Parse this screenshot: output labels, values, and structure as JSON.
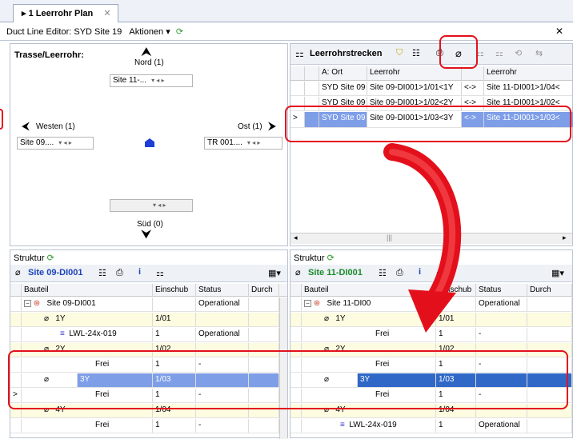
{
  "tab": {
    "title": "1 Leerrohr Plan",
    "close": "✕"
  },
  "editor": {
    "title": "Duct Line Editor: SYD Site 19",
    "actions": "Aktionen ▾",
    "close": "✕"
  },
  "left": {
    "heading": "Trasse/Leerrohr:",
    "nord": "Nord (1)",
    "nord_combo": "Site 11-...",
    "westen": "Westen (1)",
    "west_combo": "Site 09....",
    "ost": "Ost (1)",
    "ost_combo": "TR 001....",
    "sued": "Süd (0)"
  },
  "right": {
    "title": "Leerrohrstrecken",
    "columns": [
      "A: Ort",
      "Leerrohr",
      "",
      "Leerrohr"
    ],
    "rows": [
      [
        "SYD Site 09",
        "Site 09-DI001>1/01<1Y",
        "<->",
        "Site 11-DI001>1/04<"
      ],
      [
        "SYD Site 09",
        "Site 09-DI001>1/02<2Y",
        "<->",
        "Site 11-DI001>1/02<"
      ],
      [
        "SYD Site 09",
        "Site 09-DI001>1/03<3Y",
        "<->",
        "Site 11-DI001>1/03<"
      ]
    ]
  },
  "struct_left": {
    "label": "Struktur",
    "site": "Site 09-DI001",
    "columns": [
      "Bauteil",
      "Einschub",
      "Status",
      "Durch"
    ],
    "rows": [
      {
        "name": "Site 09-DI001",
        "einschub": "",
        "status": "Operational"
      },
      {
        "name": "1Y",
        "einschub": "1/01",
        "status": ""
      },
      {
        "name": "LWL-24x-019",
        "einschub": "1",
        "status": "Operational"
      },
      {
        "name": "2Y",
        "einschub": "1/02",
        "status": ""
      },
      {
        "name": "Frei",
        "einschub": "1",
        "status": "-"
      },
      {
        "name": "3Y",
        "einschub": "1/03",
        "status": ""
      },
      {
        "name": "Frei",
        "einschub": "1",
        "status": "-"
      },
      {
        "name": "4Y",
        "einschub": "1/04",
        "status": ""
      },
      {
        "name": "Frei",
        "einschub": "1",
        "status": "-"
      }
    ]
  },
  "struct_right": {
    "label": "Struktur",
    "site": "Site 11-DI001",
    "columns": [
      "Bauteil",
      "Einschub",
      "Status",
      "Durch"
    ],
    "rows": [
      {
        "name": "Site 11-DI00",
        "einschub": "",
        "status": "Operational"
      },
      {
        "name": "1Y",
        "einschub": "1/01",
        "status": ""
      },
      {
        "name": "Frei",
        "einschub": "1",
        "status": "-"
      },
      {
        "name": "2Y",
        "einschub": "1/02",
        "status": ""
      },
      {
        "name": "Frei",
        "einschub": "1",
        "status": "-"
      },
      {
        "name": "3Y",
        "einschub": "1/03",
        "status": ""
      },
      {
        "name": "Frei",
        "einschub": "1",
        "status": "-"
      },
      {
        "name": "4Y",
        "einschub": "1/04",
        "status": ""
      },
      {
        "name": "LWL-24x-019",
        "einschub": "1",
        "status": "Operational"
      }
    ]
  },
  "colors": {
    "highlight": "#e3101c",
    "selection": "#2f68c7",
    "arrow": "#e3101c"
  }
}
